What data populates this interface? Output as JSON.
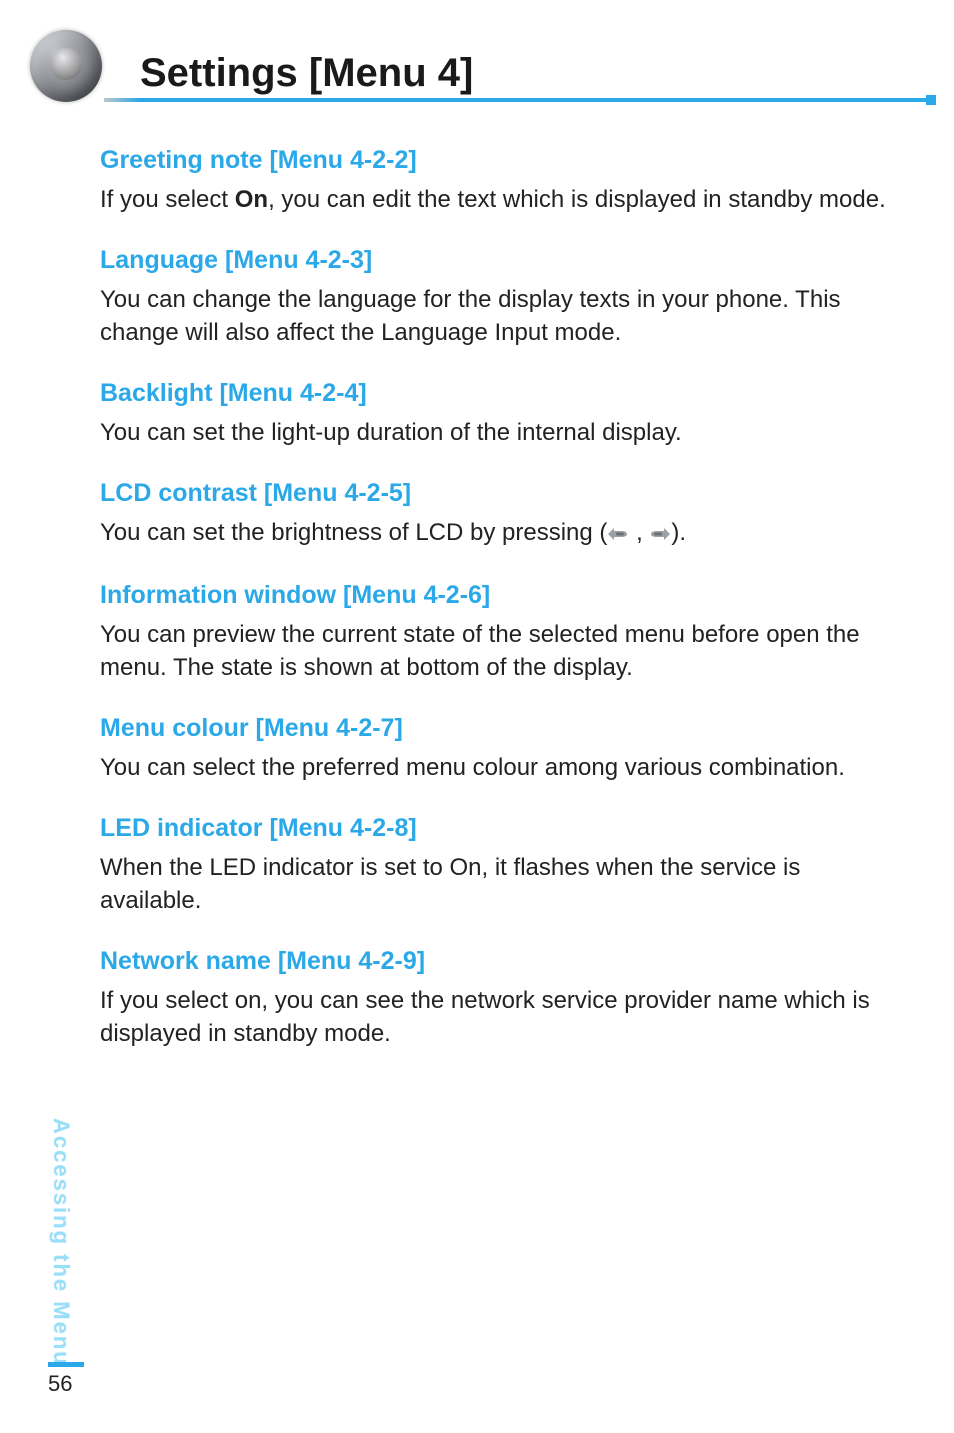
{
  "header": {
    "title": "Settings [Menu 4]"
  },
  "sections": [
    {
      "heading": "Greeting note [Menu 4-2-2]",
      "body_pre": "If you select ",
      "body_bold": "On",
      "body_post": ", you can edit the text which is displayed in standby mode."
    },
    {
      "heading": "Language [Menu 4-2-3]",
      "body": "You can change the language for the display texts in your phone. This change will also affect the Language Input mode."
    },
    {
      "heading": "Backlight [Menu 4-2-4]",
      "body": "You can set the light-up duration of the internal display."
    },
    {
      "heading": "LCD contrast [Menu 4-2-5]",
      "body_pre": "You can set the brightness of LCD by pressing (",
      "body_post": ")."
    },
    {
      "heading": "Information window [Menu 4-2-6]",
      "body": "You can preview the current state of the selected menu before open the menu. The state is shown at bottom of the display."
    },
    {
      "heading": "Menu colour [Menu 4-2-7]",
      "body": "You can select the preferred menu colour among various combination."
    },
    {
      "heading": "LED indicator [Menu 4-2-8]",
      "body": "When the LED indicator is set to On, it flashes when the service is available."
    },
    {
      "heading": "Network name [Menu 4-2-9]",
      "body": "If you select on, you can see the network service provider name which is displayed in standby mode."
    }
  ],
  "side_label": "Accessing the Menu",
  "page_number": "56",
  "icons": {
    "left_key": "left-nav-key-icon",
    "right_key": "right-nav-key-icon",
    "separator": " , "
  }
}
